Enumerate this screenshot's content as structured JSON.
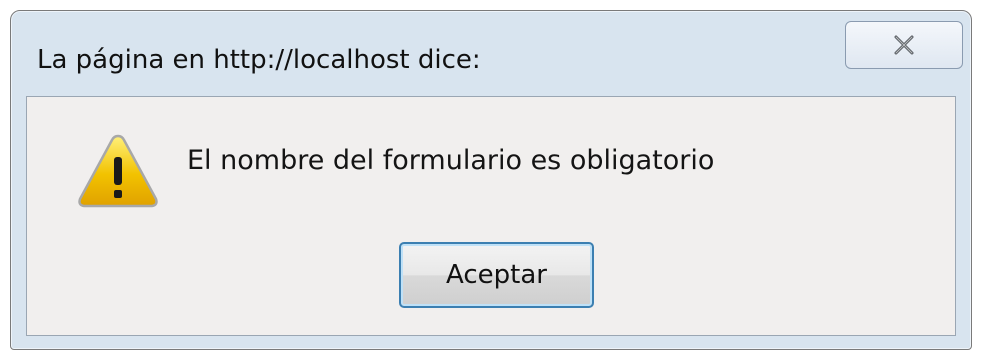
{
  "dialog": {
    "title": "La página en http://localhost dice:",
    "message": "El nombre del formulario es obligatorio",
    "ok_label": "Aceptar",
    "icon": "warning-icon",
    "close_icon": "close-icon"
  },
  "colors": {
    "frame": "#d8e4ef",
    "client": "#f1efee",
    "warning_fill": "#f2c200",
    "button_focus_border": "#3c7fb1"
  }
}
